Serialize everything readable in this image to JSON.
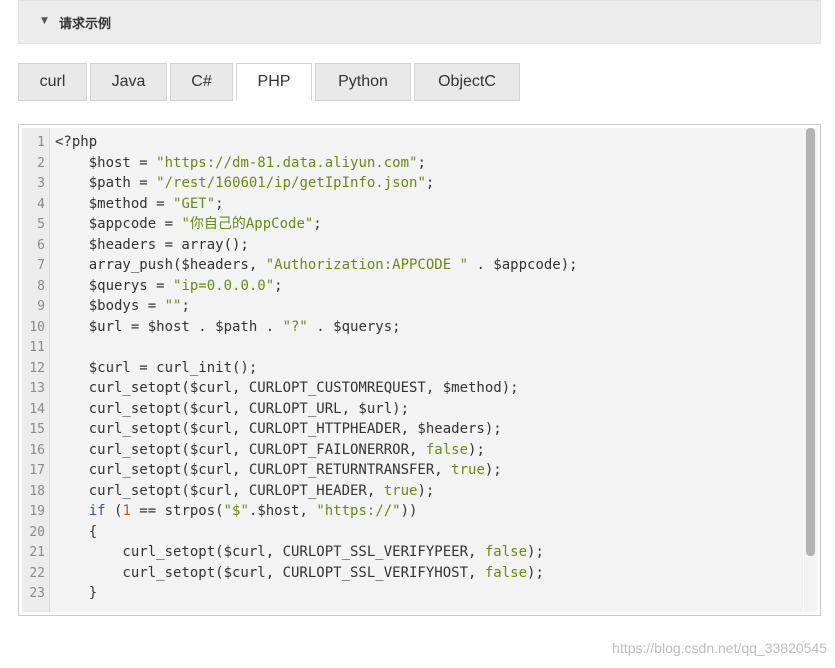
{
  "section": {
    "title": "请求示例",
    "caret_icon": "caret-down-icon"
  },
  "tabs": [
    {
      "label": "curl",
      "active": false
    },
    {
      "label": "Java",
      "active": false
    },
    {
      "label": "C#",
      "active": false
    },
    {
      "label": "PHP",
      "active": true
    },
    {
      "label": "Python",
      "active": false
    },
    {
      "label": "ObjectC",
      "active": false
    }
  ],
  "colors": {
    "string": "#6a8a12",
    "keyword": "#3a4fb8",
    "number": "#b15a1e",
    "text": "#333333"
  },
  "code": {
    "language": "PHP",
    "lines": [
      {
        "n": "1",
        "tokens": [
          [
            "<?php",
            "t"
          ]
        ]
      },
      {
        "n": "2",
        "tokens": [
          [
            "    $host = ",
            "t"
          ],
          [
            "\"https://dm-81.data.aliyun.com\"",
            "s"
          ],
          [
            ";",
            "t"
          ]
        ]
      },
      {
        "n": "3",
        "tokens": [
          [
            "    $path = ",
            "t"
          ],
          [
            "\"/rest/160601/ip/getIpInfo.json\"",
            "s"
          ],
          [
            ";",
            "t"
          ]
        ]
      },
      {
        "n": "4",
        "tokens": [
          [
            "    $method = ",
            "t"
          ],
          [
            "\"GET\"",
            "s"
          ],
          [
            ";",
            "t"
          ]
        ]
      },
      {
        "n": "5",
        "tokens": [
          [
            "    $appcode = ",
            "t"
          ],
          [
            "\"你自己的AppCode\"",
            "s"
          ],
          [
            ";",
            "t"
          ]
        ]
      },
      {
        "n": "6",
        "tokens": [
          [
            "    $headers = array();",
            "t"
          ]
        ]
      },
      {
        "n": "7",
        "tokens": [
          [
            "    array_push($headers, ",
            "t"
          ],
          [
            "\"Authorization:APPCODE \"",
            "s"
          ],
          [
            " . $appcode);",
            "t"
          ]
        ]
      },
      {
        "n": "8",
        "tokens": [
          [
            "    $querys = ",
            "t"
          ],
          [
            "\"ip=0.0.0.0\"",
            "s"
          ],
          [
            ";",
            "t"
          ]
        ]
      },
      {
        "n": "9",
        "tokens": [
          [
            "    $bodys = ",
            "t"
          ],
          [
            "\"\"",
            "s"
          ],
          [
            ";",
            "t"
          ]
        ]
      },
      {
        "n": "10",
        "tokens": [
          [
            "    $url = $host . $path . ",
            "t"
          ],
          [
            "\"?\"",
            "s"
          ],
          [
            " . $querys;",
            "t"
          ]
        ]
      },
      {
        "n": "11",
        "tokens": [
          [
            "",
            "t"
          ]
        ]
      },
      {
        "n": "12",
        "tokens": [
          [
            "    $curl = curl_init();",
            "t"
          ]
        ]
      },
      {
        "n": "13",
        "tokens": [
          [
            "    curl_setopt($curl, CURLOPT_CUSTOMREQUEST, $method);",
            "t"
          ]
        ]
      },
      {
        "n": "14",
        "tokens": [
          [
            "    curl_setopt($curl, CURLOPT_URL, $url);",
            "t"
          ]
        ]
      },
      {
        "n": "15",
        "tokens": [
          [
            "    curl_setopt($curl, CURLOPT_HTTPHEADER, $headers);",
            "t"
          ]
        ]
      },
      {
        "n": "16",
        "tokens": [
          [
            "    curl_setopt($curl, CURLOPT_FAILONERROR, ",
            "t"
          ],
          [
            "false",
            "s"
          ],
          [
            ");",
            "t"
          ]
        ]
      },
      {
        "n": "17",
        "tokens": [
          [
            "    curl_setopt($curl, CURLOPT_RETURNTRANSFER, ",
            "t"
          ],
          [
            "true",
            "s"
          ],
          [
            ");",
            "t"
          ]
        ]
      },
      {
        "n": "18",
        "tokens": [
          [
            "    curl_setopt($curl, CURLOPT_HEADER, ",
            "t"
          ],
          [
            "true",
            "s"
          ],
          [
            ");",
            "t"
          ]
        ]
      },
      {
        "n": "19",
        "tokens": [
          [
            "    ",
            "t"
          ],
          [
            "if",
            "k"
          ],
          [
            " (",
            "t"
          ],
          [
            "1",
            "u"
          ],
          [
            " == strpos(",
            "t"
          ],
          [
            "\"$\"",
            "s"
          ],
          [
            ".$host, ",
            "t"
          ],
          [
            "\"https://\"",
            "s"
          ],
          [
            "))",
            "t"
          ]
        ]
      },
      {
        "n": "20",
        "tokens": [
          [
            "    {",
            "t"
          ]
        ]
      },
      {
        "n": "21",
        "tokens": [
          [
            "        curl_setopt($curl, CURLOPT_SSL_VERIFYPEER, ",
            "t"
          ],
          [
            "false",
            "s"
          ],
          [
            ");",
            "t"
          ]
        ]
      },
      {
        "n": "22",
        "tokens": [
          [
            "        curl_setopt($curl, CURLOPT_SSL_VERIFYHOST, ",
            "t"
          ],
          [
            "false",
            "s"
          ],
          [
            ");",
            "t"
          ]
        ]
      },
      {
        "n": "23",
        "tokens": [
          [
            "    }",
            "t"
          ]
        ]
      }
    ]
  },
  "watermark": "https://blog.csdn.net/qq_33820545"
}
